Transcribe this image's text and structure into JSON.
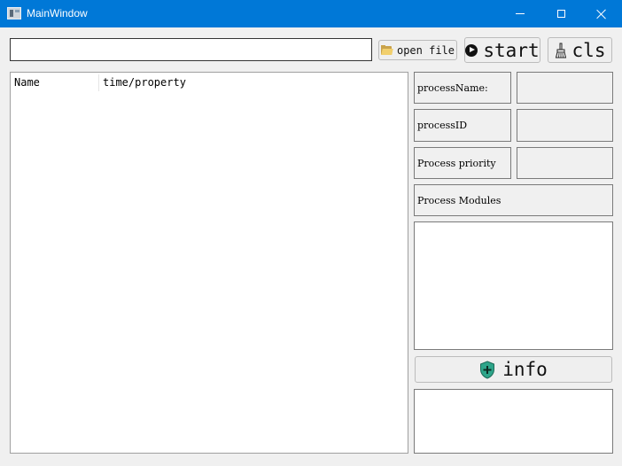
{
  "window": {
    "title": "MainWindow"
  },
  "toolbar": {
    "path_value": "",
    "open_label": "open file",
    "start_label": "start",
    "cls_label": "cls"
  },
  "list": {
    "columns": [
      "Name",
      "time/property"
    ]
  },
  "props": {
    "process_name_label": "processName:",
    "process_id_label": "processID",
    "priority_label": "Process priority",
    "modules_label": "Process Modules"
  },
  "info_label": "info",
  "icons": {
    "open": "folder-icon",
    "start": "play-icon",
    "cls": "broom-icon",
    "info": "shield-plus-icon"
  },
  "colors": {
    "titlebar": "#0078d7",
    "shield": "#2ea58a"
  }
}
